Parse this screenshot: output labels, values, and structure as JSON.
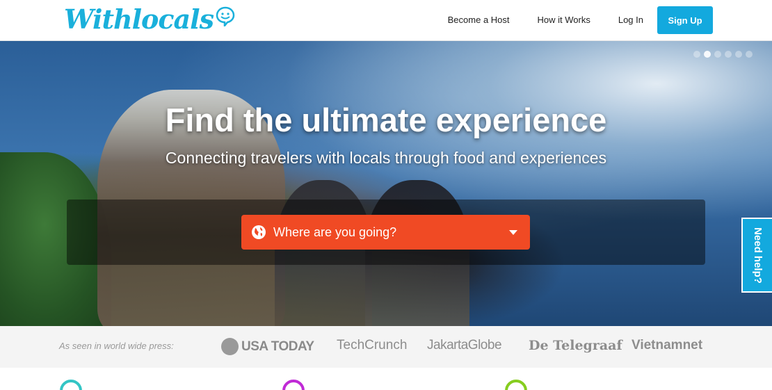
{
  "header": {
    "logo_text": "Withlocals",
    "nav": {
      "become_host": "Become a Host",
      "how_it_works": "How it Works",
      "log_in": "Log In",
      "sign_up": "Sign Up"
    }
  },
  "hero": {
    "title": "Find the ultimate experience",
    "subtitle": "Connecting travelers with locals through food and experiences",
    "search_label": "Where are you going?",
    "slide_count": 6,
    "active_slide": 2
  },
  "help_tab": "Need help?",
  "press": {
    "label": "As seen in world wide press:",
    "logos": {
      "usa_today": "USA TODAY",
      "techcrunch": "TechCrunch",
      "jakarta_globe": "JakartaGlobe",
      "telegraaf": "De Telegraaf",
      "vietnamnet": "Vietnamnet"
    }
  },
  "colors": {
    "brand_blue": "#13a9de",
    "search_orange": "#f04a24",
    "icon_teal": "#33c5c5",
    "icon_purple": "#c02ad6",
    "icon_green": "#86cd1f"
  }
}
